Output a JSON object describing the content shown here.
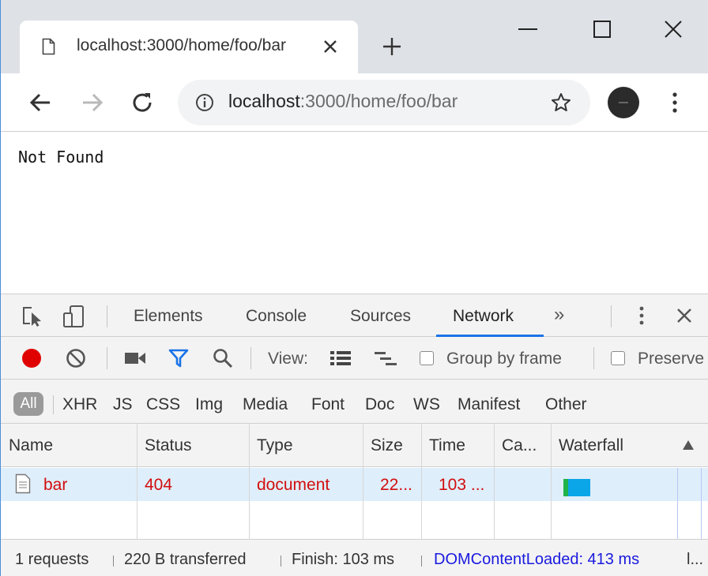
{
  "tab": {
    "title": "localhost:3000/home/foo/bar"
  },
  "omnibox": {
    "url_host": "localhost",
    "url_rest": ":3000/home/foo/bar"
  },
  "page": {
    "body_text": "Not Found"
  },
  "devtools": {
    "panels": [
      "Elements",
      "Console",
      "Sources",
      "Network"
    ],
    "more_panels": "»",
    "active_panel": "Network",
    "network_toolbar": {
      "view_label": "View:",
      "group_by_frame": "Group by frame",
      "preserve_log": "Preserve"
    },
    "filters": [
      "All",
      "XHR",
      "JS",
      "CSS",
      "Img",
      "Media",
      "Font",
      "Doc",
      "WS",
      "Manifest",
      "Other"
    ],
    "active_filter": "All",
    "columns": [
      "Name",
      "Status",
      "Type",
      "Size",
      "Time",
      "Ca...",
      "Waterfall"
    ],
    "rows": [
      {
        "name": "bar",
        "status": "404",
        "type": "document",
        "size": "22...",
        "time": "103 ..."
      }
    ],
    "status": {
      "requests": "1 requests",
      "transferred": "220 B transferred",
      "finish": "Finish: 103 ms",
      "dom_loaded": "DOMContentLoaded: 413 ms",
      "more": "l..."
    }
  },
  "colors": {
    "accent": "#1a73e8",
    "error_text": "#d20e0e",
    "record": "#e00000",
    "dom_loaded": "#1a1adf",
    "selected_row": "#dfeefb"
  }
}
